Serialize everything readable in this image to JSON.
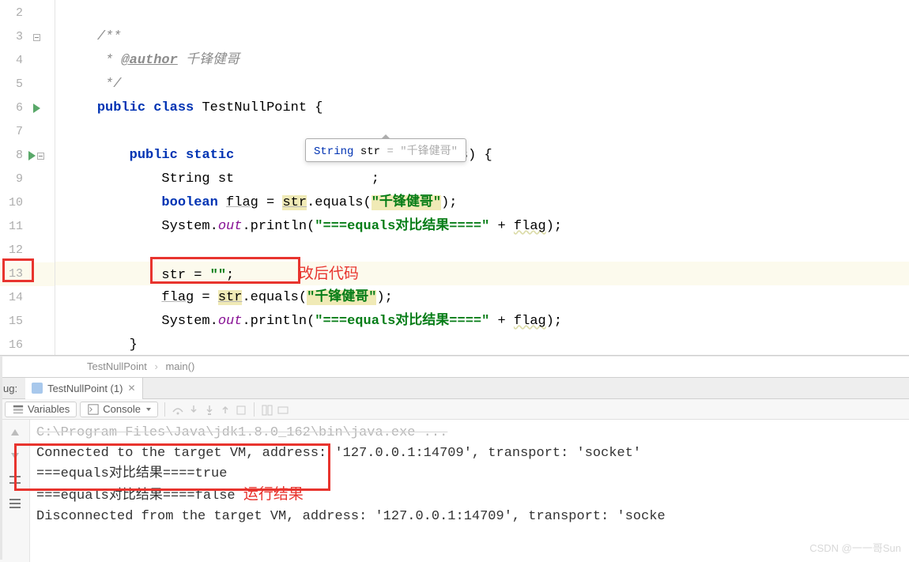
{
  "code": {
    "lines": {
      "l3doc": "/**",
      "l4doc_pre": " * ",
      "l4_tag": "@author",
      "l4_val": " 千锋健哥",
      "l5doc": " */",
      "l6": {
        "public": "public",
        "class": "class",
        "name": "TestNullPoint",
        "open": " {"
      },
      "l8": {
        "public": "public",
        "static": "static",
        "gap": "      ",
        "sig_mid": "ing[] args) {"
      },
      "l9": {
        "type": "String st",
        "tail": ";"
      },
      "l10": {
        "bool": "boolean",
        "flag": "flag",
        "eq": " = ",
        "str": "str",
        "method": ".equals(",
        "lit": "\"千锋健哥\"",
        "close": ");"
      },
      "l11": {
        "sys": "System.",
        "out": "out",
        "pr": ".println(",
        "msg": "\"===equals对比结果====\"",
        "plus": " + ",
        "flag": "flag",
        "close": ");"
      },
      "l13": {
        "assign": "str = ",
        "lit": "\"\"",
        "close": ";"
      },
      "l13_note": "改后代码",
      "l14": {
        "flag": "flag",
        "eq": " = ",
        "str": "str",
        "method": ".equals(",
        "lit": "\"千锋健哥\"",
        "close": ");"
      },
      "l15": {
        "sys": "System.",
        "out": "out",
        "pr": ".println(",
        "msg": "\"===equals对比结果====\"",
        "plus": " + ",
        "flag": "flag",
        "close": ");"
      },
      "l16": "}"
    },
    "line_numbers": [
      "2",
      "3",
      "4",
      "5",
      "6",
      "7",
      "8",
      "9",
      "10",
      "11",
      "12",
      "13",
      "14",
      "15",
      "16"
    ]
  },
  "tooltip": {
    "type": "String",
    "name": " str ",
    "val": "= \"千锋健哥\""
  },
  "breadcrumbs": {
    "a": "TestNullPoint",
    "b": "main()"
  },
  "debug": {
    "label": "ug:",
    "tab": "TestNullPoint (1)"
  },
  "toolbar": {
    "variables": "Variables",
    "console": "Console"
  },
  "console": {
    "l0": "C:\\Program Files\\Java\\jdk1.8.0_162\\bin\\java.exe ...",
    "l1": "Connected to the target VM, address: '127.0.0.1:14709', transport: 'socket'",
    "l2": "===equals对比结果====true",
    "l3": "===equals对比结果====false",
    "l3_note": "运行结果",
    "l4": "Disconnected from the target VM, address: '127.0.0.1:14709', transport: 'socke"
  },
  "watermark": "CSDN @一一哥Sun"
}
